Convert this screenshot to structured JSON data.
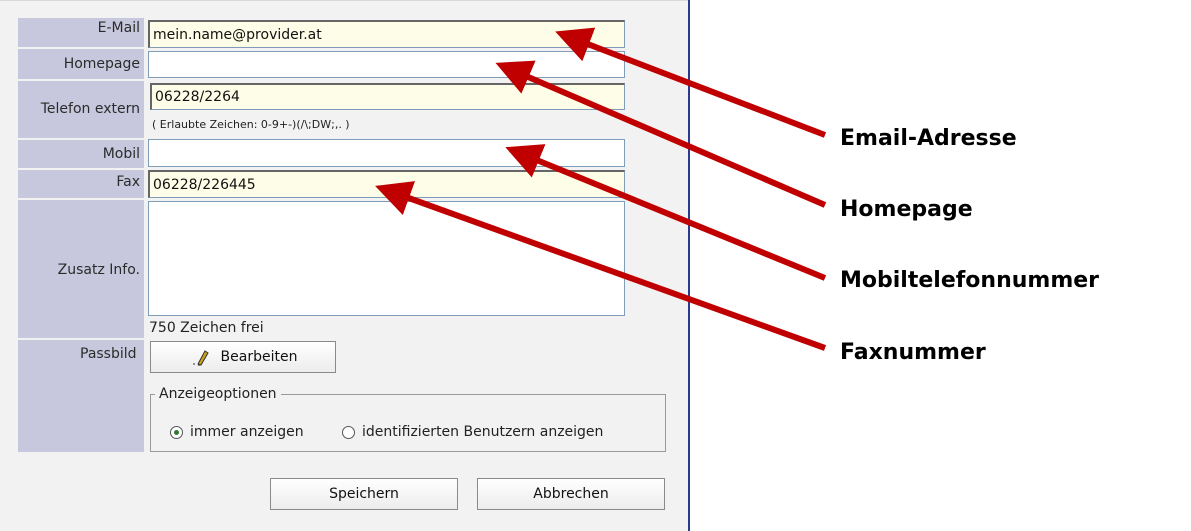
{
  "form": {
    "email": {
      "label": "E-Mail",
      "value": "mein.name@provider.at"
    },
    "homepage": {
      "label": "Homepage",
      "value": ""
    },
    "telefon": {
      "label": "Telefon extern",
      "value": "06228/2264",
      "hint": "( Erlaubte Zeichen: 0-9+-)(/\\;DW;,. )"
    },
    "mobil": {
      "label": "Mobil",
      "value": ""
    },
    "fax": {
      "label": "Fax",
      "value": "06228/226445"
    },
    "zusatz": {
      "label": "Zusatz Info.",
      "value": "",
      "chars_left": "750 Zeichen frei"
    },
    "passbild": {
      "label": "Passbild",
      "button": "Bearbeiten"
    },
    "anzeige": {
      "legend": "Anzeigeoptionen",
      "options": [
        "immer anzeigen",
        "identifizierten Benutzern anzeigen"
      ],
      "selected": "immer anzeigen"
    },
    "actions": {
      "save": "Speichern",
      "cancel": "Abbrechen"
    }
  },
  "callouts": {
    "email": "Email-Adresse",
    "homepage": "Homepage",
    "mobil": "Mobiltelefonnummer",
    "fax": "Faxnummer"
  },
  "colors": {
    "arrow": "#c00000",
    "label_bg": "#c7c8dd",
    "panel_bg": "#f2f2f2",
    "panel_border": "#2a3b8f"
  }
}
